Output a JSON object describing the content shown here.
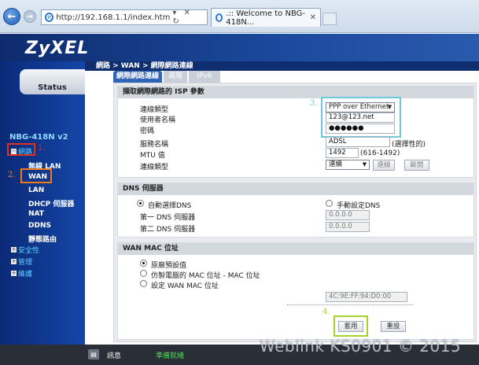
{
  "browser": {
    "url": "http://192.168.1.1/index.htm",
    "address_tools": "▾ ✕ ↻",
    "tab_title": ".:: Welcome to NBG-418N...",
    "tab_close": "✕"
  },
  "header": {
    "logo": "ZyXEL"
  },
  "sidebar": {
    "status": "Status",
    "model": "NBG-418N v2",
    "network": "網路",
    "items": [
      "無線 LAN",
      "WAN",
      "LAN",
      "DHCP 伺服器",
      "NAT",
      "DDNS",
      "靜態路由"
    ],
    "security": "安全性",
    "management": "管理",
    "maintenance": "維護"
  },
  "annotations": {
    "a1": "1.",
    "a2": "2.",
    "a3": "3.",
    "a4": "4."
  },
  "main": {
    "breadcrumb": "網路 > WAN > 網際網路連線",
    "tabs": [
      "網際網路連線",
      "進階",
      "IPv6"
    ]
  },
  "isp": {
    "title": "擷取網際網路的 ISP 參數",
    "type_label": "連線類型",
    "type_value": "PPP over Ethernet",
    "user_label": "使用者名稱",
    "user_value": "123@123.net",
    "pwd_label": "密碼",
    "pwd_value": "●●●●●●",
    "service_label": "服務名稱",
    "service_value": "ADSL",
    "service_hint": "(選擇性的)",
    "mtu_label": "MTU 值",
    "mtu_value": "1492",
    "mtu_hint": "(616-1492)",
    "conn_label": "連線類型",
    "conn_value": "連續",
    "connect_btn": "連線",
    "disconnect_btn": "斷開"
  },
  "dns": {
    "title": "DNS 伺服器",
    "auto": "自動選擇DNS",
    "manual": "手動設定DNS",
    "dns1_label": "第一 DNS 伺服器",
    "dns1_value": "0.0.0.0",
    "dns2_label": "第二 DNS 伺服器",
    "dns2_value": "0.0.0.0"
  },
  "mac": {
    "title": "WAN MAC 位址",
    "opt1": "原廠預設值",
    "opt2": "仿製電腦的 MAC 位址 - MAC 位址",
    "opt3": "設定 WAN MAC 位址",
    "mac_value": "4C:9E:FF:94:D0:00"
  },
  "actions": {
    "apply": "套用",
    "reset": "重設"
  },
  "footer": {
    "info": "訊息",
    "status": "準備就緒"
  },
  "watermark": "Weblink KS0901 © 2015",
  "colors": {
    "red": "#e0301e",
    "orange": "#f07a1a",
    "cyan": "#6fc7d9",
    "green": "#a6d22c"
  }
}
